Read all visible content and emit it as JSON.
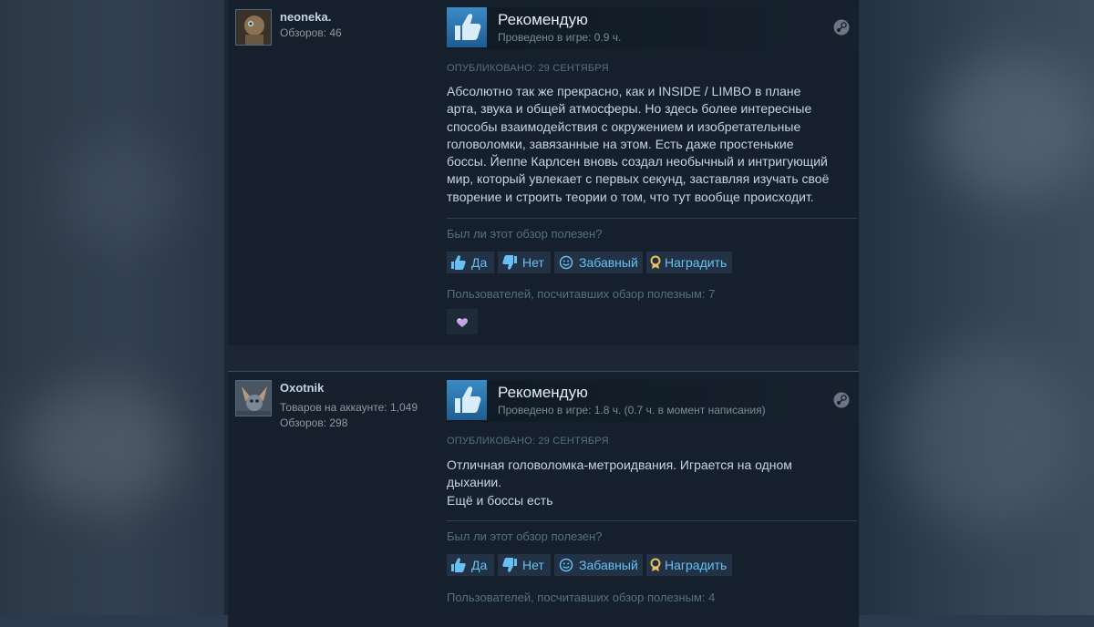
{
  "reviews": [
    {
      "author": "neoneka.",
      "meta_lines": [
        "Обзоров: 46"
      ],
      "verdict": "Рекомендую",
      "hours": "Проведено в игре: 0.9 ч.",
      "posted": "ОПУБЛИКОВАНО: 29 СЕНТЯБРЯ",
      "body_lines": [
        "Абсолютно так же прекрасно, как и INSIDE / LIMBO в плане",
        "арта, звука и общей атмосферы. Но здесь более интересные",
        "способы взаимодействия с окружением и изобретательные",
        "головоломки, завязанные на этом. Есть даже простенькие",
        "боссы. Йеппе Карлсен вновь создал необычный и интригующий",
        "мир, который увлекает с первых секунд, заставляя изучать своё",
        "творение и строить теории о том, что тут вообще происходит."
      ],
      "helpful_question": "Был ли этот обзор полезен?",
      "buttons": {
        "yes": "Да",
        "no": "Нет",
        "funny": "Забавный",
        "award": "Наградить"
      },
      "helpful_count": "Пользователей, посчитавших обзор полезным: 7"
    },
    {
      "author": "Oxotnik",
      "meta_lines": [
        "Товаров на аккаунте: 1,049",
        "Обзоров: 298"
      ],
      "verdict": "Рекомендую",
      "hours": "Проведено в игре: 1.8 ч. (0.7 ч. в момент написания)",
      "posted": "ОПУБЛИКОВАНО: 29 СЕНТЯБРЯ",
      "body_lines": [
        "Отличная головоломка-метроидвания. Играется на одном",
        "дыхании.",
        "Ещё и боссы есть"
      ],
      "helpful_question": "Был ли этот обзор полезен?",
      "buttons": {
        "yes": "Да",
        "no": "Нет",
        "funny": "Забавный",
        "award": "Наградить"
      },
      "helpful_count": "Пользователей, посчитавших обзор полезным: 4"
    }
  ],
  "colors": {
    "link": "#66c0f4",
    "thumb": "#3a8bc7",
    "award_badge": "#c8a2e8"
  },
  "icons": [
    "thumbs-up-icon",
    "thumbs-down-icon",
    "smile-icon",
    "award-icon",
    "steam-icon"
  ]
}
